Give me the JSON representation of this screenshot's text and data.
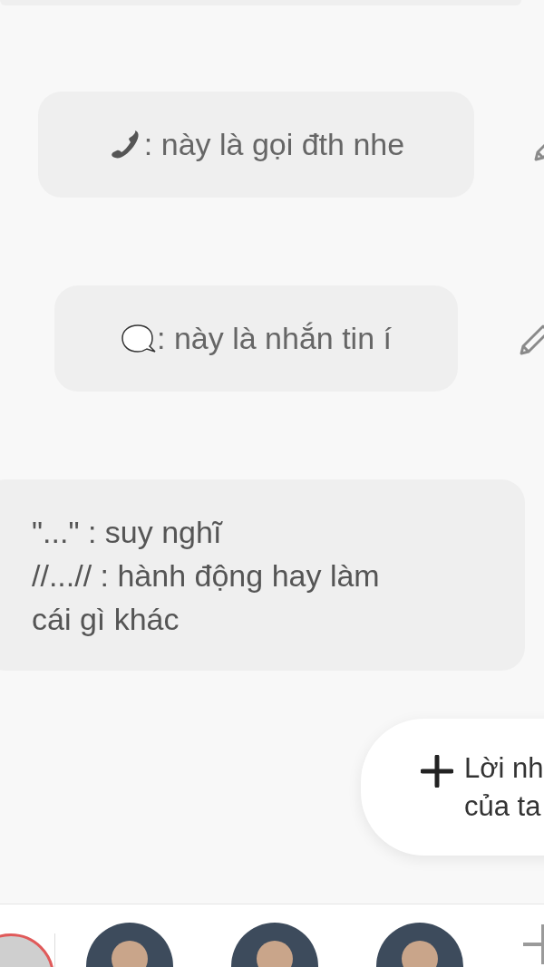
{
  "messages": [
    {
      "kind": "phone",
      "text": ": này là gọi đth nhe"
    },
    {
      "kind": "chat",
      "text": ": này là nhắn tin í"
    },
    {
      "kind": "plain",
      "lines": [
        "\"...\" : suy nghĩ",
        "//...// : hành động hay làm",
        "cái gì khác"
      ]
    }
  ],
  "add_button": {
    "lines": [
      "Lời nh",
      "của ta"
    ]
  },
  "bottom_bar": {
    "items": [
      {
        "kind": "self"
      },
      {
        "kind": "contact"
      },
      {
        "kind": "contact"
      },
      {
        "kind": "contact"
      },
      {
        "kind": "add"
      }
    ]
  }
}
